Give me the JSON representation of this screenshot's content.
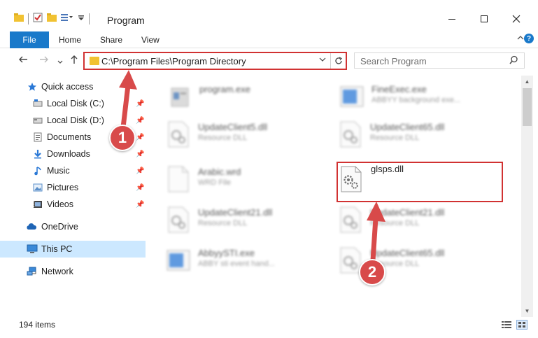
{
  "window": {
    "title": "Program",
    "minimize_icon": "minimize-icon",
    "maximize_icon": "maximize-icon",
    "close_icon": "close-icon"
  },
  "ribbon": {
    "tabs": [
      {
        "label": "File"
      },
      {
        "label": "Home"
      },
      {
        "label": "Share"
      },
      {
        "label": "View"
      }
    ]
  },
  "navigation": {
    "address_path": "C:\\Program Files\\Program Directory",
    "search_placeholder": "Search Program"
  },
  "sidebar": {
    "items": [
      {
        "label": "Quick access",
        "icon": "star-icon"
      },
      {
        "label": "Local Disk (C:)",
        "icon": "drive-icon"
      },
      {
        "label": "Local Disk (D:)",
        "icon": "drive-icon"
      },
      {
        "label": "Documents",
        "icon": "documents-icon"
      },
      {
        "label": "Downloads",
        "icon": "download-icon"
      },
      {
        "label": "Music",
        "icon": "music-icon"
      },
      {
        "label": "Pictures",
        "icon": "pictures-icon"
      },
      {
        "label": "Videos",
        "icon": "videos-icon"
      },
      {
        "label": "OneDrive",
        "icon": "cloud-icon"
      },
      {
        "label": "This PC",
        "icon": "computer-icon"
      },
      {
        "label": "Network",
        "icon": "network-icon"
      }
    ]
  },
  "files": [
    {
      "name": "program.exe",
      "desc": ""
    },
    {
      "name": "FineExec.exe",
      "desc": "ABBYY background exe..."
    },
    {
      "name": "UpdateClient5.dll",
      "desc": "Resource DLL"
    },
    {
      "name": "UpdateClient65.dll",
      "desc": "Resource DLL"
    },
    {
      "name": "Arabic.wrd",
      "desc": "WRD File"
    },
    {
      "name": "glsps.dll",
      "desc": ""
    },
    {
      "name": "UpdateClient21.dll",
      "desc": "Resource DLL"
    },
    {
      "name": "UpdateClient21.dll",
      "desc": "Resource DLL"
    },
    {
      "name": "AbbyySTI.exe",
      "desc": "ABBY sti event hand..."
    },
    {
      "name": "UpdateClient65.dll",
      "desc": "Resource DLL"
    }
  ],
  "status": {
    "item_count": "194 items"
  },
  "annotations": {
    "step1": "1",
    "step2": "2",
    "color": "#d84a4a"
  }
}
